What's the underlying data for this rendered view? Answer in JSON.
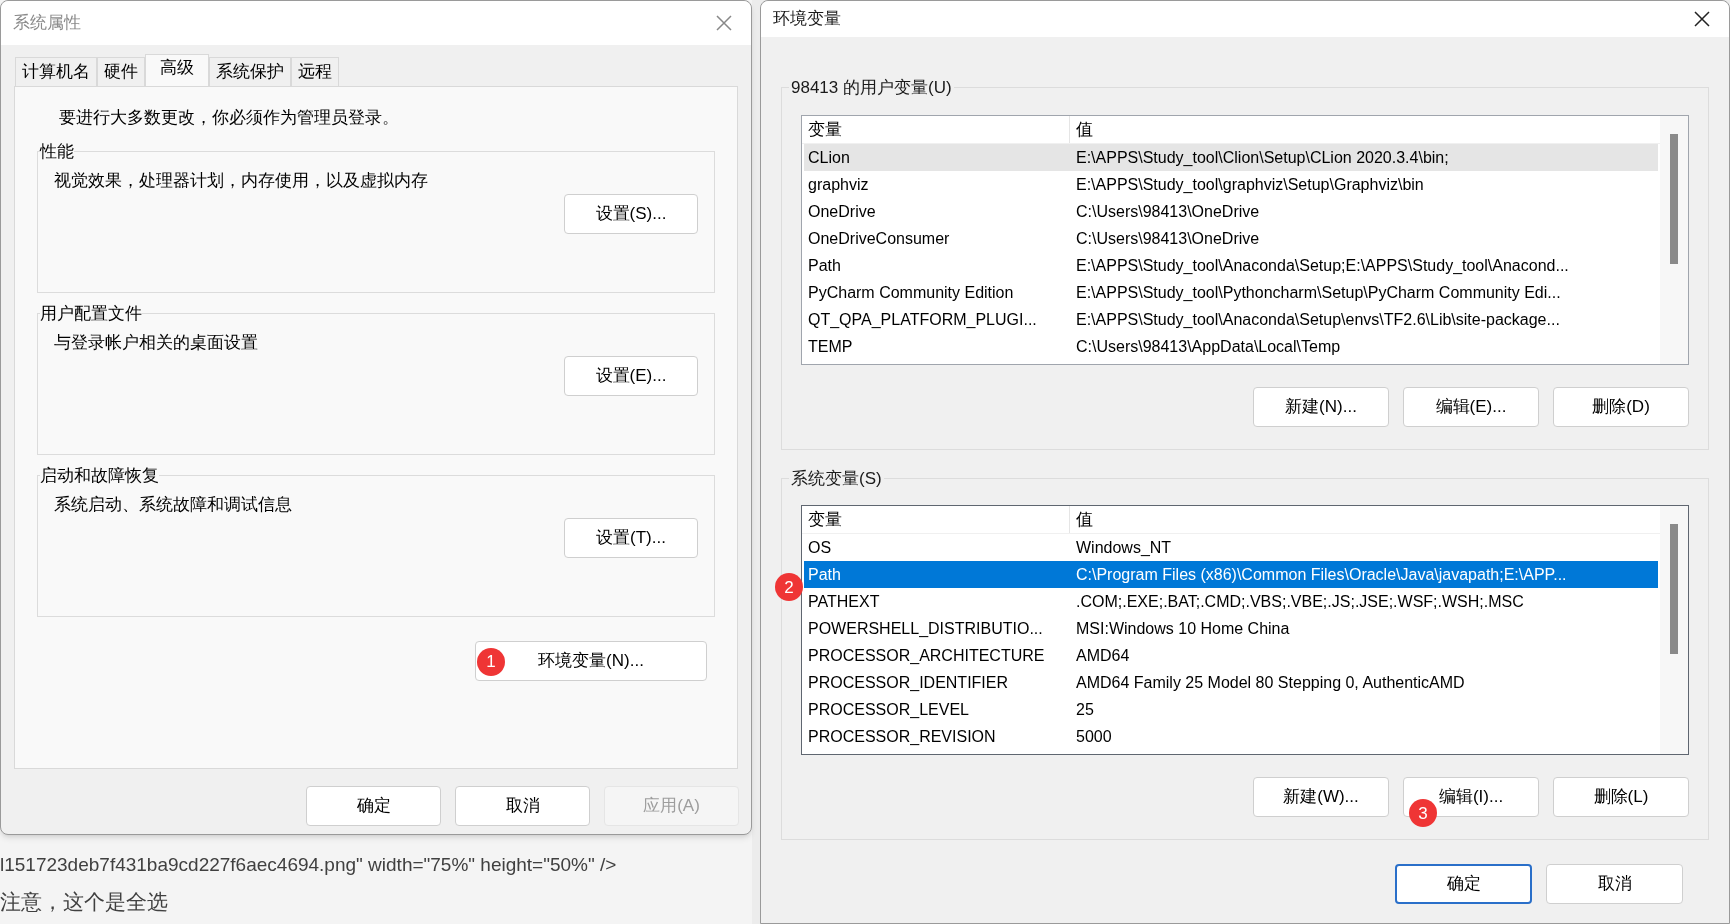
{
  "system_properties": {
    "title": "系统属性",
    "tabs": [
      {
        "label": "计算机名",
        "selected": false
      },
      {
        "label": "硬件",
        "selected": false
      },
      {
        "label": "高级",
        "selected": true
      },
      {
        "label": "系统保护",
        "selected": false
      },
      {
        "label": "远程",
        "selected": false
      }
    ],
    "notice": "要进行大多数更改，你必须作为管理员登录。",
    "groups": [
      {
        "title": "性能",
        "description": "视觉效果，处理器计划，内存使用，以及虚拟内存",
        "button": "设置(S)..."
      },
      {
        "title": "用户配置文件",
        "description": "与登录帐户相关的桌面设置",
        "button": "设置(E)..."
      },
      {
        "title": "启动和故障恢复",
        "description": "系统启动、系统故障和调试信息",
        "button": "设置(T)..."
      }
    ],
    "env_button": {
      "label": "环境变量(N)...",
      "badge": "1"
    },
    "buttons": [
      {
        "label": "确定",
        "disabled": false
      },
      {
        "label": "取消",
        "disabled": false
      },
      {
        "label": "应用(A)",
        "disabled": true
      }
    ]
  },
  "background_text": [
    "l151723deb7f431ba9cd227f6aec4694.png\" width=\"75%\" height=\"50%\" />",
    "注意，这个是全选"
  ],
  "environment_variables": {
    "title": "环境变量",
    "user_variables": {
      "title": "98413 的用户变量(U)",
      "focused": false,
      "columns": [
        "变量",
        "值"
      ],
      "rows": [
        {
          "name": "CLion",
          "value": "E:\\APPS\\Study_tool\\Clion\\Setup\\CLion 2020.3.4\\bin;",
          "selected": true
        },
        {
          "name": "graphviz",
          "value": "E:\\APPS\\Study_tool\\graphviz\\Setup\\Graphviz\\bin",
          "selected": false
        },
        {
          "name": "OneDrive",
          "value": "C:\\Users\\98413\\OneDrive",
          "selected": false
        },
        {
          "name": "OneDriveConsumer",
          "value": "C:\\Users\\98413\\OneDrive",
          "selected": false
        },
        {
          "name": "Path",
          "value": "E:\\APPS\\Study_tool\\Anaconda\\Setup;E:\\APPS\\Study_tool\\Anacond...",
          "selected": false
        },
        {
          "name": "PyCharm Community Edition",
          "value": "E:\\APPS\\Study_tool\\Pythoncharm\\Setup\\PyCharm Community Edi...",
          "selected": false
        },
        {
          "name": "QT_QPA_PLATFORM_PLUGI...",
          "value": "E:\\APPS\\Study_tool\\Anaconda\\Setup\\envs\\TF2.6\\Lib\\site-package...",
          "selected": false
        },
        {
          "name": "TEMP",
          "value": "C:\\Users\\98413\\AppData\\Local\\Temp",
          "selected": false
        }
      ],
      "buttons": [
        {
          "label": "新建(N)..."
        },
        {
          "label": "编辑(E)..."
        },
        {
          "label": "删除(D)"
        }
      ]
    },
    "system_variables": {
      "title": "系统变量(S)",
      "focused": true,
      "columns": [
        "变量",
        "值"
      ],
      "rows": [
        {
          "name": "OS",
          "value": "Windows_NT",
          "selected": false
        },
        {
          "name": "Path",
          "value": "C:\\Program Files (x86)\\Common Files\\Oracle\\Java\\javapath;E:\\APP...",
          "selected": true,
          "badge": "2"
        },
        {
          "name": "PATHEXT",
          "value": ".COM;.EXE;.BAT;.CMD;.VBS;.VBE;.JS;.JSE;.WSF;.WSH;.MSC",
          "selected": false
        },
        {
          "name": "POWERSHELL_DISTRIBUTIO...",
          "value": "MSI:Windows 10 Home China",
          "selected": false
        },
        {
          "name": "PROCESSOR_ARCHITECTURE",
          "value": "AMD64",
          "selected": false
        },
        {
          "name": "PROCESSOR_IDENTIFIER",
          "value": "AMD64 Family 25 Model 80 Stepping 0, AuthenticAMD",
          "selected": false
        },
        {
          "name": "PROCESSOR_LEVEL",
          "value": "25",
          "selected": false
        },
        {
          "name": "PROCESSOR_REVISION",
          "value": "5000",
          "selected": false
        }
      ],
      "buttons": [
        {
          "label": "新建(W)..."
        },
        {
          "label": "编辑(I)...",
          "badge": "3"
        },
        {
          "label": "删除(L)"
        }
      ]
    },
    "buttons": [
      {
        "label": "确定",
        "default": true
      },
      {
        "label": "取消",
        "default": false
      }
    ]
  }
}
